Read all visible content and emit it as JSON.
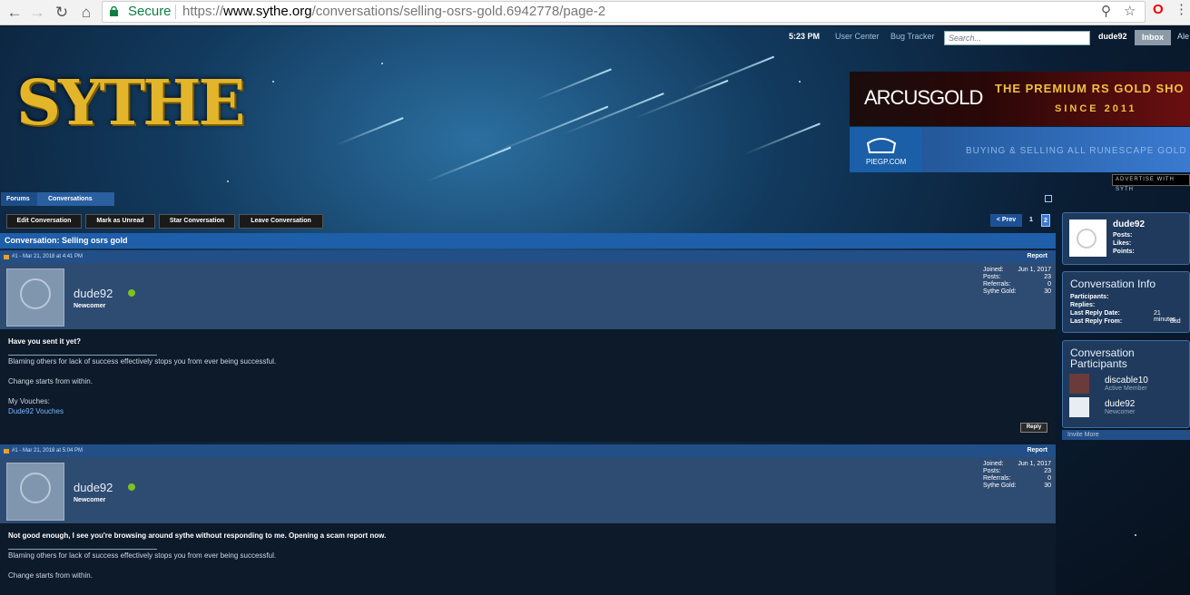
{
  "browser": {
    "secure_label": "Secure",
    "url_scheme": "https://",
    "url_host": "www.sythe.org",
    "url_path": "/conversations/selling-osrs-gold.6942778/page-2"
  },
  "topbar": {
    "time": "5:23 PM",
    "user_center": "User Center",
    "bug_tracker": "Bug Tracker",
    "search_placeholder": "Search...",
    "username": "dude92",
    "inbox": "Inbox",
    "alerts": "Ale"
  },
  "logo": {
    "text": "SYTHE"
  },
  "ads": {
    "ad1_brand": "ARCUSGOLD",
    "ad1_line1": "THE PREMIUM RS GOLD SHO",
    "ad1_line2": "SINCE 2011",
    "ad2_brand": "PIEGP.COM",
    "ad2_slogan": "BUYING & SELLING ALL RUNESCAPE GOLD",
    "advertise": "ADVERTISE WITH SYTH"
  },
  "breadcrumb": [
    "Forums",
    "Conversations"
  ],
  "actions": [
    "Edit Conversation",
    "Mark as Unread",
    "Star Conversation",
    "Leave Conversation"
  ],
  "pagination": {
    "prev": "< Prev",
    "p1": "1",
    "p2": "2"
  },
  "conversation": {
    "title": "Conversation: Selling osrs gold"
  },
  "posts": [
    {
      "header": "#1 - Mar 21, 2018 at 4:41 PM",
      "report": "Report",
      "author": "dude92",
      "rank": "Newcomer",
      "stats": [
        {
          "k": "Joined:",
          "v": "Jun 1, 2017"
        },
        {
          "k": "Posts:",
          "v": "23"
        },
        {
          "k": "Referrals:",
          "v": "0"
        },
        {
          "k": "Sythe Gold:",
          "v": "30"
        }
      ],
      "message": "Have you sent it yet?",
      "sig1": "Blaming others for lack of success effectively stops you from ever being successful.",
      "sig2": "Change starts from within.",
      "sig3": "My Vouches:",
      "vouch_link": "Dude92 Vouches",
      "reply": "Reply"
    },
    {
      "header": "#1 - Mar 21, 2018 at 5:04 PM",
      "report": "Report",
      "author": "dude92",
      "rank": "Newcomer",
      "stats": [
        {
          "k": "Joined:",
          "v": "Jun 1, 2017"
        },
        {
          "k": "Posts:",
          "v": "23"
        },
        {
          "k": "Referrals:",
          "v": "0"
        },
        {
          "k": "Sythe Gold:",
          "v": "30"
        }
      ],
      "message": "Not good enough, I see you're browsing around sythe without responding to me. Opening a scam report now.",
      "sig1": "Blaming others for lack of success effectively stops you from ever being successful.",
      "sig2": "Change starts from within."
    }
  ],
  "sidebar": {
    "profile": {
      "name": "dude92",
      "posts": "Posts:",
      "likes": "Likes:",
      "points": "Points:"
    },
    "info": {
      "title": "Conversation Info",
      "participants": "Participants:",
      "replies": "Replies:",
      "last_reply_date": "Last Reply Date:",
      "last_reply_date_v": "21 minutes",
      "last_reply_from": "Last Reply From:",
      "last_reply_from_v": "dud"
    },
    "participants": {
      "title_l1": "Conversation",
      "title_l2": "Participants",
      "list": [
        {
          "name": "discable10",
          "rank": "Active Member"
        },
        {
          "name": "dude92",
          "rank": "Newcomer"
        }
      ],
      "invite": "Invite More"
    }
  },
  "colors": {
    "accent": "#1f5ea8",
    "online": "#7cc221",
    "link": "#7ab6ff",
    "logo_gold": "#e2b52a"
  }
}
